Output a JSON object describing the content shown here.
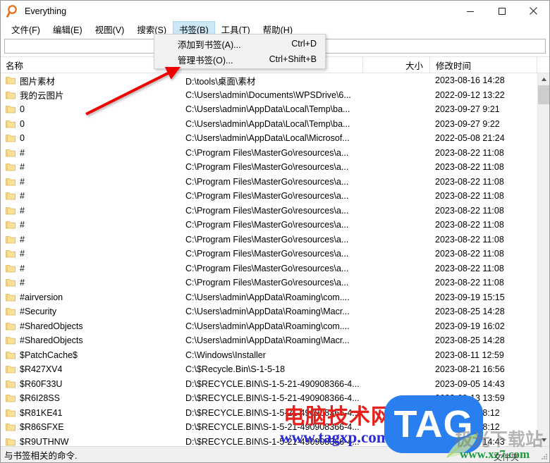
{
  "window": {
    "title": "Everything",
    "icon": "magnifier-icon",
    "minimize": "minimize-icon",
    "maximize": "maximize-icon",
    "close": "close-icon"
  },
  "menubar": {
    "items": [
      {
        "label": "文件(F)",
        "active": false
      },
      {
        "label": "编辑(E)",
        "active": false
      },
      {
        "label": "视图(V)",
        "active": false
      },
      {
        "label": "搜索(S)",
        "active": false
      },
      {
        "label": "书签(B)",
        "active": true
      },
      {
        "label": "工具(T)",
        "active": false
      },
      {
        "label": "帮助(H)",
        "active": false
      }
    ]
  },
  "dropdown": {
    "open_for": "书签(B)",
    "items": [
      {
        "label": "添加到书签(A)...",
        "accel": "Ctrl+D"
      },
      {
        "label": "管理书签(O)...",
        "accel": "Ctrl+Shift+B"
      }
    ]
  },
  "search": {
    "value": "",
    "placeholder": ""
  },
  "columns": [
    {
      "key": "name",
      "label": "名称"
    },
    {
      "key": "path",
      "label": ""
    },
    {
      "key": "size",
      "label": "大小"
    },
    {
      "key": "date",
      "label": "修改时间"
    }
  ],
  "rows": [
    {
      "name": "图片素材",
      "path": "D:\\tools\\桌面\\素材",
      "size": "",
      "date": "2023-08-16 14:28"
    },
    {
      "name": "我的云图片",
      "path": "C:\\Users\\admin\\Documents\\WPSDrive\\6...",
      "size": "",
      "date": "2022-09-12 13:22"
    },
    {
      "name": "0",
      "path": "C:\\Users\\admin\\AppData\\Local\\Temp\\ba...",
      "size": "",
      "date": "2023-09-27 9:21"
    },
    {
      "name": "0",
      "path": "C:\\Users\\admin\\AppData\\Local\\Temp\\ba...",
      "size": "",
      "date": "2023-09-27 9:22"
    },
    {
      "name": "0",
      "path": "C:\\Users\\admin\\AppData\\Local\\Microsof...",
      "size": "",
      "date": "2022-05-08 21:24"
    },
    {
      "name": "#",
      "path": "C:\\Program Files\\MasterGo\\resources\\a...",
      "size": "",
      "date": "2023-08-22 11:08"
    },
    {
      "name": "#",
      "path": "C:\\Program Files\\MasterGo\\resources\\a...",
      "size": "",
      "date": "2023-08-22 11:08"
    },
    {
      "name": "#",
      "path": "C:\\Program Files\\MasterGo\\resources\\a...",
      "size": "",
      "date": "2023-08-22 11:08"
    },
    {
      "name": "#",
      "path": "C:\\Program Files\\MasterGo\\resources\\a...",
      "size": "",
      "date": "2023-08-22 11:08"
    },
    {
      "name": "#",
      "path": "C:\\Program Files\\MasterGo\\resources\\a...",
      "size": "",
      "date": "2023-08-22 11:08"
    },
    {
      "name": "#",
      "path": "C:\\Program Files\\MasterGo\\resources\\a...",
      "size": "",
      "date": "2023-08-22 11:08"
    },
    {
      "name": "#",
      "path": "C:\\Program Files\\MasterGo\\resources\\a...",
      "size": "",
      "date": "2023-08-22 11:08"
    },
    {
      "name": "#",
      "path": "C:\\Program Files\\MasterGo\\resources\\a...",
      "size": "",
      "date": "2023-08-22 11:08"
    },
    {
      "name": "#",
      "path": "C:\\Program Files\\MasterGo\\resources\\a...",
      "size": "",
      "date": "2023-08-22 11:08"
    },
    {
      "name": "#",
      "path": "C:\\Program Files\\MasterGo\\resources\\a...",
      "size": "",
      "date": "2023-08-22 11:08"
    },
    {
      "name": "#airversion",
      "path": "C:\\Users\\admin\\AppData\\Roaming\\com....",
      "size": "",
      "date": "2023-09-19 15:15"
    },
    {
      "name": "#Security",
      "path": "C:\\Users\\admin\\AppData\\Roaming\\Macr...",
      "size": "",
      "date": "2023-08-25 14:28"
    },
    {
      "name": "#SharedObjects",
      "path": "C:\\Users\\admin\\AppData\\Roaming\\com....",
      "size": "",
      "date": "2023-09-19 16:02"
    },
    {
      "name": "#SharedObjects",
      "path": "C:\\Users\\admin\\AppData\\Roaming\\Macr...",
      "size": "",
      "date": "2023-08-25 14:28"
    },
    {
      "name": "$PatchCache$",
      "path": "C:\\Windows\\Installer",
      "size": "",
      "date": "2023-08-11 12:59"
    },
    {
      "name": "$R427XV4",
      "path": "C:\\$Recycle.Bin\\S-1-5-18",
      "size": "",
      "date": "2023-08-21 16:56"
    },
    {
      "name": "$R60F33U",
      "path": "D:\\$RECYCLE.BIN\\S-1-5-21-490908366-4...",
      "size": "",
      "date": "2023-09-05 14:43"
    },
    {
      "name": "$R6I28SS",
      "path": "D:\\$RECYCLE.BIN\\S-1-5-21-490908366-4...",
      "size": "",
      "date": "2023-09-13 13:59"
    },
    {
      "name": "$R81KE41",
      "path": "D:\\$RECYCLE.BIN\\S-1-5-21-490908366-4...",
      "size": "",
      "date": "2023-09-06 8:12"
    },
    {
      "name": "$R86SFXE",
      "path": "D:\\$RECYCLE.BIN\\S-1-5-21-490908366-4...",
      "size": "",
      "date": "2023-09-06 8:12"
    },
    {
      "name": "$R9UTHNW",
      "path": "D:\\$RECYCLE.BIN\\S-1-5-21-490908366-4...",
      "size": "",
      "date": "2023-09-05 14:43"
    }
  ],
  "statusbar": {
    "text": "与书签相关的命令."
  },
  "watermarks": {
    "site_cn": "电脑技术网",
    "site_url": "www.tagxp.com",
    "tag_logo": "TAG",
    "xz_cn": "极光下载站",
    "xz_url": "www.xz7.com",
    "folder_label": "文件夹"
  },
  "annotation": {
    "arrow_color": "#ee0000"
  },
  "colors": {
    "menu_highlight": "#cce8f6",
    "folder_icon": "#fbe09a",
    "accent_orange": "#e8711a"
  }
}
